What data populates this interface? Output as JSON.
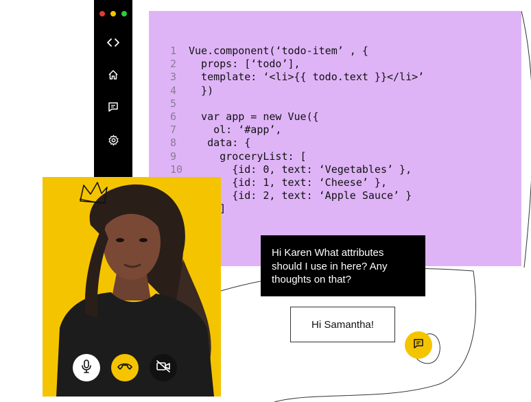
{
  "window": {
    "controls": [
      "close",
      "minimize",
      "maximize"
    ],
    "colors": {
      "close": "#e53935",
      "minimize": "#f5c400",
      "maximize": "#2ecc40"
    }
  },
  "sidebar": {
    "items": [
      {
        "name": "code",
        "icon": "code-icon"
      },
      {
        "name": "home",
        "icon": "home-icon"
      },
      {
        "name": "messages",
        "icon": "message-icon"
      },
      {
        "name": "settings",
        "icon": "gear-icon"
      }
    ]
  },
  "code": {
    "lines": [
      {
        "n": "1",
        "text": "Vue.component(‘todo-item’ , {"
      },
      {
        "n": "2",
        "text": "  props: [‘todo’],"
      },
      {
        "n": "3",
        "text": "  template: ‘<li>{{ todo.text }}</li>’"
      },
      {
        "n": "4",
        "text": "  })"
      },
      {
        "n": "5",
        "text": ""
      },
      {
        "n": "6",
        "text": "  var app = new Vue({"
      },
      {
        "n": "7",
        "text": "    ol: ‘#app’,"
      },
      {
        "n": "8",
        "text": "   data: {"
      },
      {
        "n": "9",
        "text": "     groceryList: ["
      },
      {
        "n": "10",
        "text": "       {id: 0, text: ‘Vegetables’ },"
      },
      {
        "n": "",
        "text": "       {id: 1, text: ‘Cheese’ },"
      },
      {
        "n": "",
        "text": "       {id: 2, text: ‘Apple Sauce’ }"
      },
      {
        "n": "",
        "text": "     ]"
      },
      {
        "n": "",
        "text": "   }"
      },
      {
        "n": "",
        "text": " })"
      }
    ]
  },
  "chat": {
    "incoming": "Hi Karen What attributes should I use in here? Any thoughts on that?",
    "outgoing": "Hi Samantha!"
  },
  "call_controls": [
    {
      "name": "mic",
      "icon": "microphone-icon"
    },
    {
      "name": "end-call",
      "icon": "hang-up-icon"
    },
    {
      "name": "camera",
      "icon": "camera-off-icon"
    }
  ],
  "colors": {
    "accent": "#f5c400",
    "code_bg": "#dfb4f7",
    "dark": "#000000"
  }
}
